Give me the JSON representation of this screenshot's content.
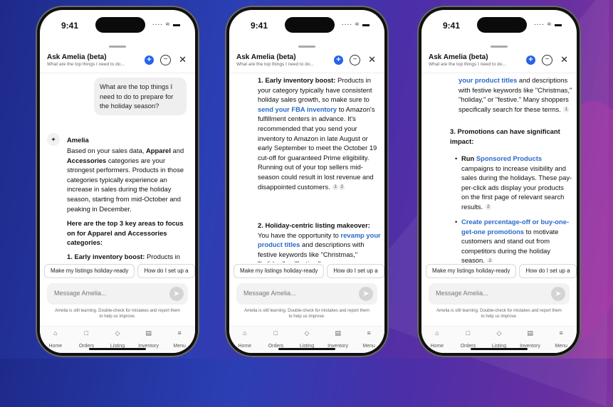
{
  "status": {
    "time": "9:41",
    "signal": "∙∙∙∙ ≈ ▬"
  },
  "header": {
    "title": "Ask Amelia (beta)",
    "subtitle": "What are the top things I need to do...",
    "plus": "+",
    "minus": "−",
    "close": "✕"
  },
  "chips": [
    "Make my listings holiday-ready",
    "How do I set up a"
  ],
  "message": {
    "placeholder": "Message Amelia...",
    "send": "➤"
  },
  "disclaimer": {
    "line1": "Amelia is still learning. Double-check for mistakes and report them",
    "line2": "to help us improve."
  },
  "tabs": [
    {
      "label": "Home",
      "icon": "⌂"
    },
    {
      "label": "Orders",
      "icon": "□"
    },
    {
      "label": "Listing",
      "icon": "◇"
    },
    {
      "label": "Inventory",
      "icon": "▤"
    },
    {
      "label": "Menu",
      "icon": "≡"
    }
  ],
  "p1": {
    "question": "What are the top things I need to do to prepare for the holiday season?",
    "amelia": "Amelia",
    "a1": "Based on your sales data, ",
    "a1b": "Apparel",
    "a1c": " and ",
    "a1d": "Accessories",
    "a1e": " categories are your strongest performers. Products in those categories typically experience an increase in sales during the holiday season, starting from mid-October and peaking in December.",
    "a2": "Here are the top 3 key areas to focus on for Apparel and Accessories categories:",
    "a3n": "1. ",
    "a3b": "Early inventory boost:",
    "a3": " Products in your category typically have"
  },
  "p2": {
    "n1": "1. ",
    "b1": "Early inventory boost:",
    "t1a": " Products in your category typically have consistent holiday sales growth, so make sure to ",
    "l1": "send your FBA inventory",
    "t1b": " to Amazon's fulfillment centers in advance. It's recommended that you send your inventory to Amazon in late August or early September to meet the October 19 cut-off for guaranteed Prime eligibility. Running out of your top sellers mid-season could result in lost revenue and disappointed customers.",
    "c1": "1",
    "c2": "2",
    "n2": "2. ",
    "b2": "Holiday-centric listing makeover:",
    "t2a": " You have the opportunity to ",
    "l2": "revamp your product titles",
    "t2b": " and descriptions with festive keywords like \"Christmas,\" \"holiday,\" or \"festive.\""
  },
  "p3": {
    "l0": "your product titles",
    "t0": " and descriptions with festive keywords like \"Christmas,\" \"holiday,\" or \"festive.\" Many shoppers specifically search for these terms.",
    "c0": "1",
    "n3": "3. ",
    "b3": "Promotions can have significant impact:",
    "r1a": "Run ",
    "r1l": "Sponsored Products",
    "r1b": " campaigns to increase visibility and sales during the holidays. These pay-per-click ads display your products on the first page of relevant search results.",
    "c1": "2",
    "r2l": "Create percentage-off or buy-one-get-one promotions",
    "r2b": " to motivate customers and stand out from competitors during the holiday season.",
    "c2": "2"
  }
}
